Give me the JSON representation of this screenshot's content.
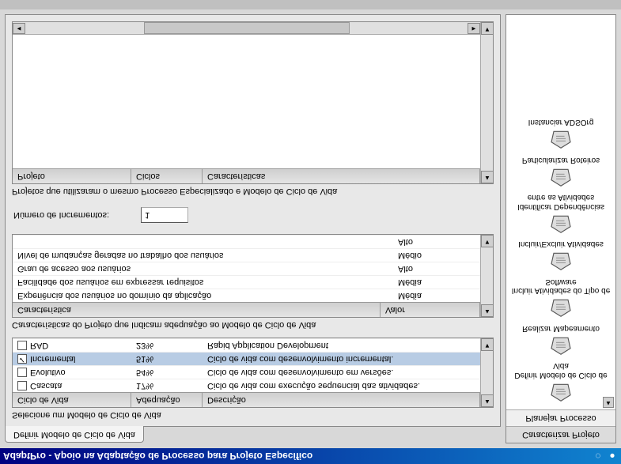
{
  "window": {
    "title": "AdaptPro - Apoio na Adaptação de Processo para Projeto Específico"
  },
  "mainTab": {
    "label": "Definir Modelo de Ciclo de Vida"
  },
  "lifecycle": {
    "section_label": "Selecione um Modelo de Ciclo de Vida",
    "headers": [
      "Ciclo de Vida",
      "Adequação",
      "Descrição"
    ],
    "rows": [
      {
        "name": "Cascata",
        "pct": "17%",
        "desc": "Ciclo de vida com execução sequencial das atividades.",
        "checked": false,
        "selected": false
      },
      {
        "name": "Evolutivo",
        "pct": "54%",
        "desc": "Ciclo de vida com desenvolvimento em versões.",
        "checked": false,
        "selected": false
      },
      {
        "name": "Incremental",
        "pct": "51%",
        "desc": "Ciclo de vida com desenvolvimento incremental.",
        "checked": true,
        "selected": true
      },
      {
        "name": "RAD",
        "pct": "23%",
        "desc": "Rapid Application Development",
        "checked": false,
        "selected": false
      }
    ]
  },
  "characteristics": {
    "section_label": "Características do Projeto que Indicam adequação ao Modelo de Ciclo de Vida",
    "headers": [
      "Característica",
      "Valor"
    ],
    "rows": [
      {
        "name": "Experiência dos usuários no domínio da aplicação",
        "value": "Média"
      },
      {
        "name": "Facilidade dos usuários em expressar requisitos",
        "value": "Média"
      },
      {
        "name": "Grau de acesso aos usuários",
        "value": "Alto"
      },
      {
        "name": "Nível de mudanças geradas no trabalho dos usuários",
        "value": "Médio"
      },
      {
        "name": "",
        "value": "Alto"
      }
    ]
  },
  "increments": {
    "label": "Número de Incrementos:",
    "value": "1"
  },
  "projects": {
    "section_label": "Projetos que utilizaram o mesmo Processo Especializado e Modelo de Ciclo de Vida",
    "headers": [
      "Projeto",
      "Ciclos",
      "Características"
    ]
  },
  "sidebar": {
    "tabs": [
      "Caracterizar Projeto",
      "Planejar Processo"
    ],
    "items": [
      "Definir Modelo de Ciclo de Vida",
      "Realizar Mapeamento",
      "Incluir Atividades do Tipo de Software",
      "Incluir/Excluir Atividades",
      "Identificar Dependências entre as Atividades",
      "Particularizar Roteiros",
      "Instanciar ADSOrg"
    ]
  }
}
